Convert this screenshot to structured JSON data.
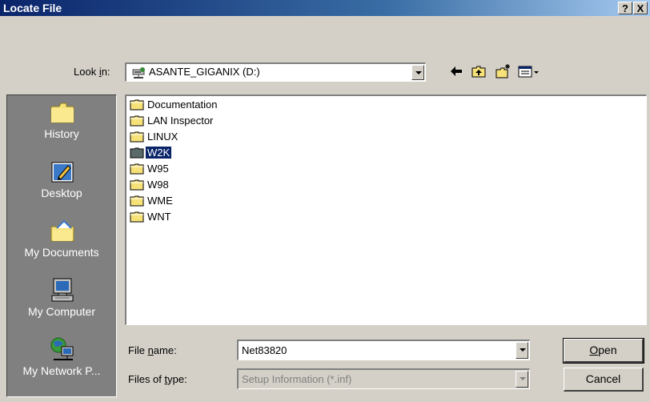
{
  "window": {
    "title": "Locate File",
    "help_button": "?",
    "close_button": "X"
  },
  "look_in": {
    "label_pre": "Look ",
    "label_accel": "i",
    "label_post": "n:",
    "value": "ASANTE_GIGANIX (D:)"
  },
  "places": [
    {
      "label": "History",
      "icon": "history-icon"
    },
    {
      "label": "Desktop",
      "icon": "desktop-icon"
    },
    {
      "label": "My Documents",
      "icon": "my-documents-icon"
    },
    {
      "label": "My Computer",
      "icon": "my-computer-icon"
    },
    {
      "label": "My Network P...",
      "icon": "my-network-places-icon"
    }
  ],
  "files": [
    {
      "name": "Documentation",
      "selected": false
    },
    {
      "name": "LAN Inspector",
      "selected": false
    },
    {
      "name": "LINUX",
      "selected": false
    },
    {
      "name": "W2K",
      "selected": true
    },
    {
      "name": "W95",
      "selected": false
    },
    {
      "name": "W98",
      "selected": false
    },
    {
      "name": "WME",
      "selected": false
    },
    {
      "name": "WNT",
      "selected": false
    }
  ],
  "file_name": {
    "label_pre": "File ",
    "label_accel": "n",
    "label_post": "ame:",
    "value": "Net83820"
  },
  "file_type": {
    "label_pre": "Files of ",
    "label_accel": "t",
    "label_post": "ype:",
    "value": "Setup Information (*.inf)"
  },
  "buttons": {
    "open_accel": "O",
    "open_rest": "pen",
    "cancel": "Cancel"
  }
}
